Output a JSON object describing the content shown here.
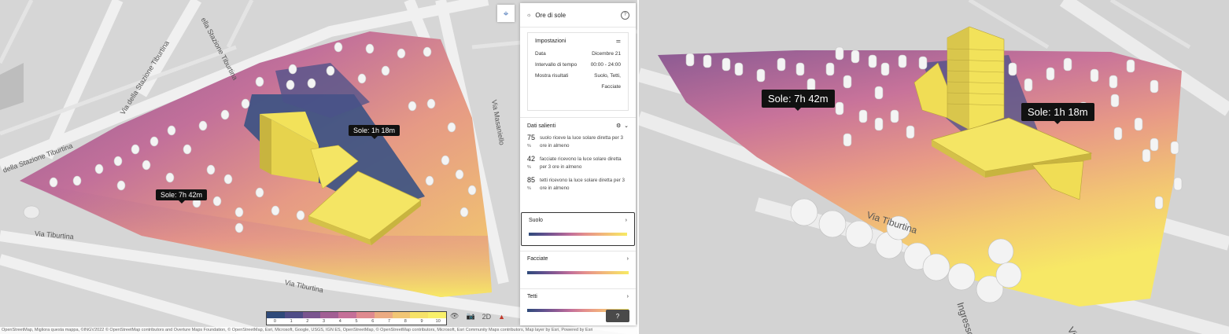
{
  "panel": {
    "title": "Ore di sole",
    "help_symbol": "?",
    "settings": {
      "title": "Impostazioni",
      "rows": [
        {
          "label": "Data",
          "value": "Dicembre 21"
        },
        {
          "label": "Intervallo di tempo",
          "value": "00:00 - 24:00"
        },
        {
          "label": "Mostra risultati",
          "value": "Suolo, Tetti, Facciate"
        }
      ]
    },
    "highlights": {
      "title": "Dati salienti",
      "stats": [
        {
          "value": "75",
          "unit": "%",
          "text": "suolo riceve la luce solare diretta per 3 ore in almeno"
        },
        {
          "value": "42",
          "unit": "%",
          "text": "facciate ricevono la luce solare diretta per 3 ore in almeno"
        },
        {
          "value": "85",
          "unit": "%",
          "text": "tetti ricevono la luce solare diretta per 3 ore in almeno"
        }
      ]
    },
    "layers": [
      {
        "label": "Suolo",
        "selected": true
      },
      {
        "label": "Facciate",
        "selected": false
      },
      {
        "label": "Tetti",
        "selected": false
      }
    ],
    "question_button": "?"
  },
  "map_labels": {
    "left_high": "Sole: 1h 18m",
    "left_low": "Sole: 7h 42m",
    "right_high": "Sole: 1h 18m",
    "right_low": "Sole: 7h 42m"
  },
  "streets": {
    "s1": "Via Tiburtina",
    "s2": "Via Tiburtina",
    "s3": "della Stazione Tiburtina",
    "s4": "Via della Stazione Tiburtina",
    "s5": "Via Masaniello",
    "s6": "ella Stazione Tiburtina",
    "s7": "Via Tiburtina",
    "s8": "Ingresso",
    "s9": "Via"
  },
  "legend": {
    "colors": [
      "#2f4a7a",
      "#4f4d87",
      "#7a558f",
      "#a26094",
      "#c57098",
      "#df8a8f",
      "#ebab82",
      "#f1c675",
      "#f6e268",
      "#f8f06a"
    ],
    "ticks": [
      "0",
      "1",
      "2",
      "3",
      "4",
      "5",
      "6",
      "7",
      "8",
      "9",
      "10"
    ]
  },
  "toolbar": {
    "two_d": "2D"
  },
  "attribution": "OpenStreetMap, Migliora questa mappa, ©INGV2022 © OpenStreetMap contributors and Overture Maps Foundation, © OpenStreetMap, Esri, Microsoft, Google, USGS, IGN ES, OpenStreetMap, © OpenStreetMap contributors, Microsoft, Esri Community Maps contributors, Map layer by Esri, Powered by Esri",
  "colors": {
    "accent": "#4a76b8",
    "building": "#f2e25a",
    "label_bg": "#111111"
  }
}
